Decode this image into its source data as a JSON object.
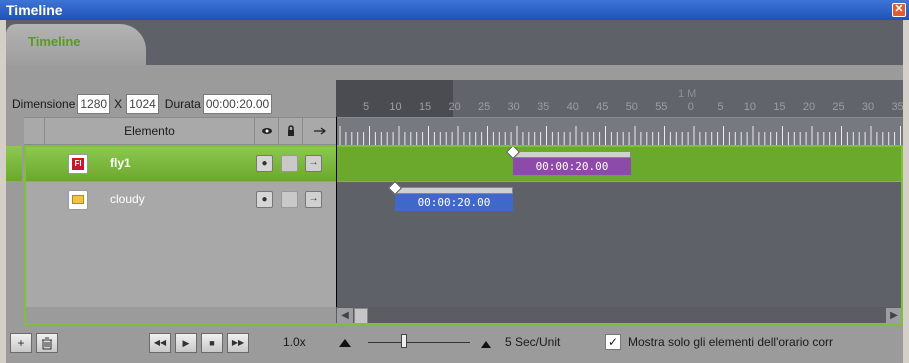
{
  "window": {
    "title": "Timeline",
    "close_glyph": "✕"
  },
  "tab": {
    "label": "Timeline"
  },
  "dimensions": {
    "label": "Dimensione",
    "width": "1280",
    "separator": "X",
    "height": "1024",
    "duration_label": "Durata",
    "duration": "00:00:20.00"
  },
  "ruler": {
    "minute_label": "1 M",
    "ticks": [
      "5",
      "10",
      "15",
      "20",
      "25",
      "30",
      "35",
      "40",
      "45",
      "50",
      "55",
      "0",
      "5",
      "10",
      "15",
      "20",
      "25",
      "30",
      "35"
    ]
  },
  "columns": {
    "element": "Elemento",
    "eye_icon": "eye-icon",
    "lock_icon": "lock-icon",
    "arrow_icon": "arrow-right-icon"
  },
  "layers": [
    {
      "name": "fly1",
      "icon_label": "Fl",
      "clip_time": "00:00:20.00",
      "clip_color": "#8e4aa8",
      "selected": true
    },
    {
      "name": "cloudy",
      "icon_label": "",
      "clip_time": "00:00:20.00",
      "clip_color": "#3f69c8",
      "selected": false
    }
  ],
  "toolbar": {
    "add_glyph": "+",
    "delete_glyph": "🗑",
    "rewind_glyph": "◀◀",
    "play_glyph": "▶",
    "stop_glyph": "■",
    "forward_glyph": "▶▶",
    "speed": "1.0x",
    "zoom_unit": "5 Sec/Unit",
    "show_only_label": "Mostra solo gli elementi dell'orario corr",
    "show_only_checked": true
  },
  "colors": {
    "accent_green": "#7fbf3a",
    "titlebar_blue": "#1f52b8"
  }
}
